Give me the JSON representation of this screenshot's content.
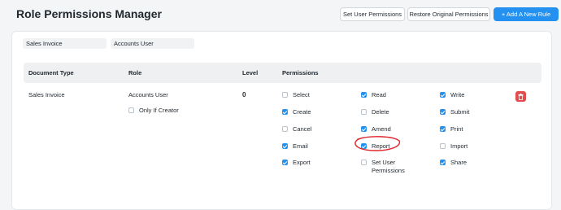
{
  "header": {
    "title": "Role Permissions Manager",
    "set_user_permissions": "Set User Permissions",
    "restore_original": "Restore Original Permissions",
    "add_rule": "+ Add A New Rule"
  },
  "filters": {
    "doctype": "Sales Invoice",
    "role": "Accounts User"
  },
  "table": {
    "headers": {
      "document_type": "Document Type",
      "role": "Role",
      "level": "Level",
      "permissions": "Permissions"
    },
    "row": {
      "document_type": "Sales Invoice",
      "role": "Accounts User",
      "only_if_creator": "Only If Creator",
      "only_if_creator_checked": false,
      "level": "0",
      "permissions": [
        {
          "label": "Select",
          "checked": false
        },
        {
          "label": "Read",
          "checked": true
        },
        {
          "label": "Write",
          "checked": true
        },
        {
          "label": "Create",
          "checked": true
        },
        {
          "label": "Delete",
          "checked": false
        },
        {
          "label": "Submit",
          "checked": true
        },
        {
          "label": "Cancel",
          "checked": false
        },
        {
          "label": "Amend",
          "checked": true
        },
        {
          "label": "Print",
          "checked": true
        },
        {
          "label": "Email",
          "checked": true
        },
        {
          "label": "Report",
          "checked": true
        },
        {
          "label": "Import",
          "checked": false
        },
        {
          "label": "Export",
          "checked": true
        },
        {
          "label": "Set User Permissions",
          "checked": false
        },
        {
          "label": "Share",
          "checked": true
        }
      ]
    }
  },
  "icons": {
    "delete": "trash-icon"
  },
  "colors": {
    "primary": "#2490ef",
    "danger": "#e24c4c",
    "annotation": "#e0262a"
  }
}
